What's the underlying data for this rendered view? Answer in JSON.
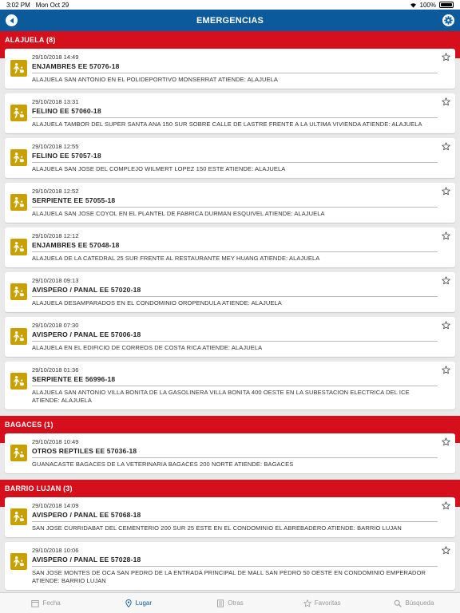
{
  "status": {
    "time": "3:02 PM",
    "date": "Mon Oct 29",
    "battery": "100%"
  },
  "header": {
    "title": "EMERGENCIAS"
  },
  "sections": [
    {
      "title": "ALAJUELA (8)",
      "items": [
        {
          "date": "29/10/2018 14:49",
          "title": "ENJAMBRES EE 57076-18",
          "desc": "ALAJUELA SAN ANTONIO EN EL POLIDEPORTIVO MONSERRAT ATIENDE: ALAJUELA"
        },
        {
          "date": "29/10/2018 13:31",
          "title": "FELINO EE 57060-18",
          "desc": "ALAJUELA TAMBOR DEL SUPER SANTA ANA 150 SUR SOBRE CALLE DE LASTRE FRENTE A LA ULTIMA VIVIENDA ATIENDE: ALAJUELA"
        },
        {
          "date": "29/10/2018 12:55",
          "title": "FELINO EE 57057-18",
          "desc": "ALAJUELA SAN JOSE DEL COMPLEJO WILMERT LOPEZ 150 ESTE ATIENDE: ALAJUELA"
        },
        {
          "date": "29/10/2018 12:52",
          "title": "SERPIENTE EE 57055-18",
          "desc": "ALAJUELA SAN JOSE COYOL EN EL PLANTEL DE FABRICA DURMAN ESQUIVEL ATIENDE: ALAJUELA"
        },
        {
          "date": "29/10/2018 12:12",
          "title": "ENJAMBRES EE 57048-18",
          "desc": "ALAJUELA DE LA CATEDRAL 25 SUR FRENTE AL RESTAURANTE MEY HUANG ATIENDE: ALAJUELA"
        },
        {
          "date": "29/10/2018 09:13",
          "title": "AVISPERO / PANAL EE 57020-18",
          "desc": "ALAJUELA DESAMPARADOS EN EL CONDOMINIO OROPENDULA ATIENDE: ALAJUELA"
        },
        {
          "date": "29/10/2018 07:30",
          "title": "AVISPERO / PANAL EE 57006-18",
          "desc": "ALAJUELA EN EL EDIFICIO DE CORREOS DE COSTA RICA ATIENDE: ALAJUELA"
        },
        {
          "date": "29/10/2018 01:36",
          "title": "SERPIENTE EE 56996-18",
          "desc": "ALAJUELA SAN ANTONIO VILLA BONITA DE LA GASOLINERA VILLA BONITA 400 OESTE EN LA SUBESTACION ELECTRICA DEL ICE ATIENDE: ALAJUELA"
        }
      ]
    },
    {
      "title": "BAGACES (1)",
      "items": [
        {
          "date": "29/10/2018 10:49",
          "title": "OTROS REPTILES EE 57036-18",
          "desc": "GUANACASTE BAGACES DE LA VETERINARIA BAGACES 200 NORTE ATIENDE: BAGACES"
        }
      ]
    },
    {
      "title": "BARRIO LUJAN (3)",
      "items": [
        {
          "date": "29/10/2018 14:09",
          "title": "AVISPERO / PANAL EE 57068-18",
          "desc": "SAN JOSE CURRIDABAT DEL CEMENTERIO 200 SUR 25 ESTE EN EL CONDOMINIO EL ABREBADERO ATIENDE: BARRIO LUJAN"
        },
        {
          "date": "29/10/2018 10:06",
          "title": "AVISPERO / PANAL EE 57028-18",
          "desc": "SAN JOSE MONTES DE OCA SAN PEDRO DE LA ENTRADA PRINCIPAL DE MALL SAN PEDRO 50 OESTE EN CONDOMINIO EMPERADOR ATIENDE: BARRIO LUJAN"
        }
      ]
    }
  ],
  "tabs": [
    {
      "label": "Fecha",
      "icon": "calendar-icon",
      "active": false
    },
    {
      "label": "Lugar",
      "icon": "location-pin-icon",
      "active": true
    },
    {
      "label": "Otras",
      "icon": "list-icon",
      "active": false
    },
    {
      "label": "Favoritas",
      "icon": "star-icon",
      "active": false
    },
    {
      "label": "Búsqueda",
      "icon": "search-icon",
      "active": false
    }
  ],
  "colors": {
    "nav": "#0a5a9c",
    "section": "#d50f1c",
    "icon_bg": "#c8a000",
    "tab_active": "#0a5a9c"
  }
}
